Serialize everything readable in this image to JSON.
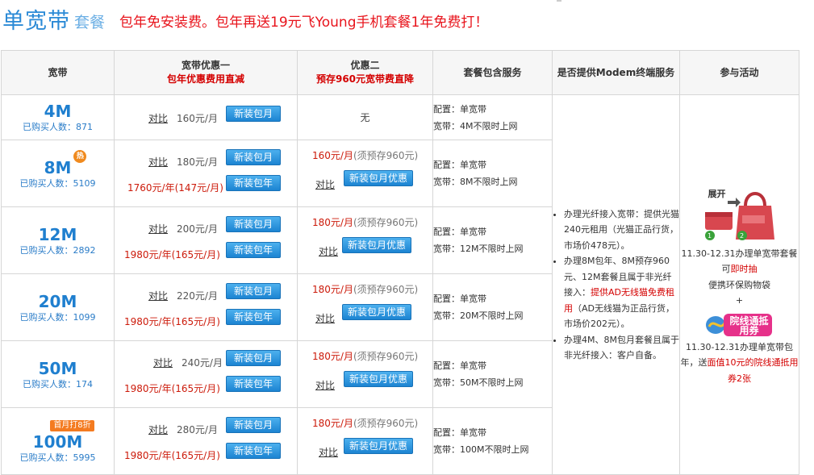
{
  "header": {
    "title": "单宽带",
    "subtitle": "套餐",
    "promo": "包年免安装费。包年再送19元飞Young手机套餐1年免费打！"
  },
  "columns": {
    "bandwidth": "宽带",
    "offer1_title": "宽带优惠一",
    "offer1_sub": "包年优惠费用直减",
    "offer2_title": "优惠二",
    "offer2_sub": "预存960元宽带费直降",
    "services": "套餐包含服务",
    "modem": "是否提供Modem终端服务",
    "activity": "参与活动"
  },
  "labels": {
    "compare": "对比",
    "monthly_btn": "新装包月",
    "yearly_btn": "新装包年",
    "monthly_promo_btn": "新装包月优惠",
    "prepay_note": "(须预存960元)",
    "none": "无",
    "hot": "热",
    "first_month": "首月打8折"
  },
  "rows": [
    {
      "speed": "4M",
      "buyers": "已购买人数：871",
      "monthly": "160元/月",
      "yearly": "",
      "offer2_price": "",
      "config": "配置：单宽带",
      "bw": "宽带：4M不限时上网"
    },
    {
      "speed": "8M",
      "buyers": "已购买人数：5109",
      "monthly": "180元/月",
      "yearly": "1760元/年(147元/月)",
      "offer2_price": "160元/月",
      "config": "配置：单宽带",
      "bw": "宽带：8M不限时上网"
    },
    {
      "speed": "12M",
      "buyers": "已购买人数：2892",
      "monthly": "200元/月",
      "yearly": "1980元/年(165元/月)",
      "offer2_price": "180元/月",
      "config": "配置：单宽带",
      "bw": "宽带：12M不限时上网"
    },
    {
      "speed": "20M",
      "buyers": "已购买人数：1099",
      "monthly": "220元/月",
      "yearly": "1980元/年(165元/月)",
      "offer2_price": "180元/月",
      "config": "配置：单宽带",
      "bw": "宽带：20M不限时上网"
    },
    {
      "speed": "50M",
      "buyers": "已购买人数：174",
      "monthly": "240元/月",
      "yearly": "1980元/年(165元/月)",
      "offer2_price": "180元/月",
      "config": "配置：单宽带",
      "bw": "宽带：50M不限时上网"
    },
    {
      "speed": "100M",
      "buyers": "已购买人数：5995",
      "monthly": "280元/月",
      "yearly": "1980元/年(165元/月)",
      "offer2_price": "180元/月",
      "config": "配置：单宽带",
      "bw": "宽带：100M不限时上网"
    }
  ],
  "modem": {
    "item1": "办理光纤接入宽带：提供光猫240元租用（光猫正品行货，市场价478元）。",
    "item2_a": "办理8M包年、8M预存960元、12M套餐且属于非光纤接入：",
    "item2_red": "提供AD无线猫免费租用",
    "item2_b": "（AD无线猫为正品行货，市场价202元）。",
    "item3": "办理4M、8M包月套餐且属于非光纤接入：客户自备。"
  },
  "activity": {
    "expand": "展开",
    "line1": "11.30-12.31办理单宽带套餐可",
    "line1_red": "即时抽",
    "line2": "便携环保购物袋",
    "plus": "+",
    "coupon_logo": "院线通抵用券",
    "line3": "11.30-12.31办理单宽带包年，送",
    "line3_red": "面值10元的院线通抵用券2张"
  },
  "colors": {
    "accent": "#2b8ad6",
    "promo_red": "#e8141c",
    "button": "#1c84d2",
    "orange": "#f47b20"
  }
}
